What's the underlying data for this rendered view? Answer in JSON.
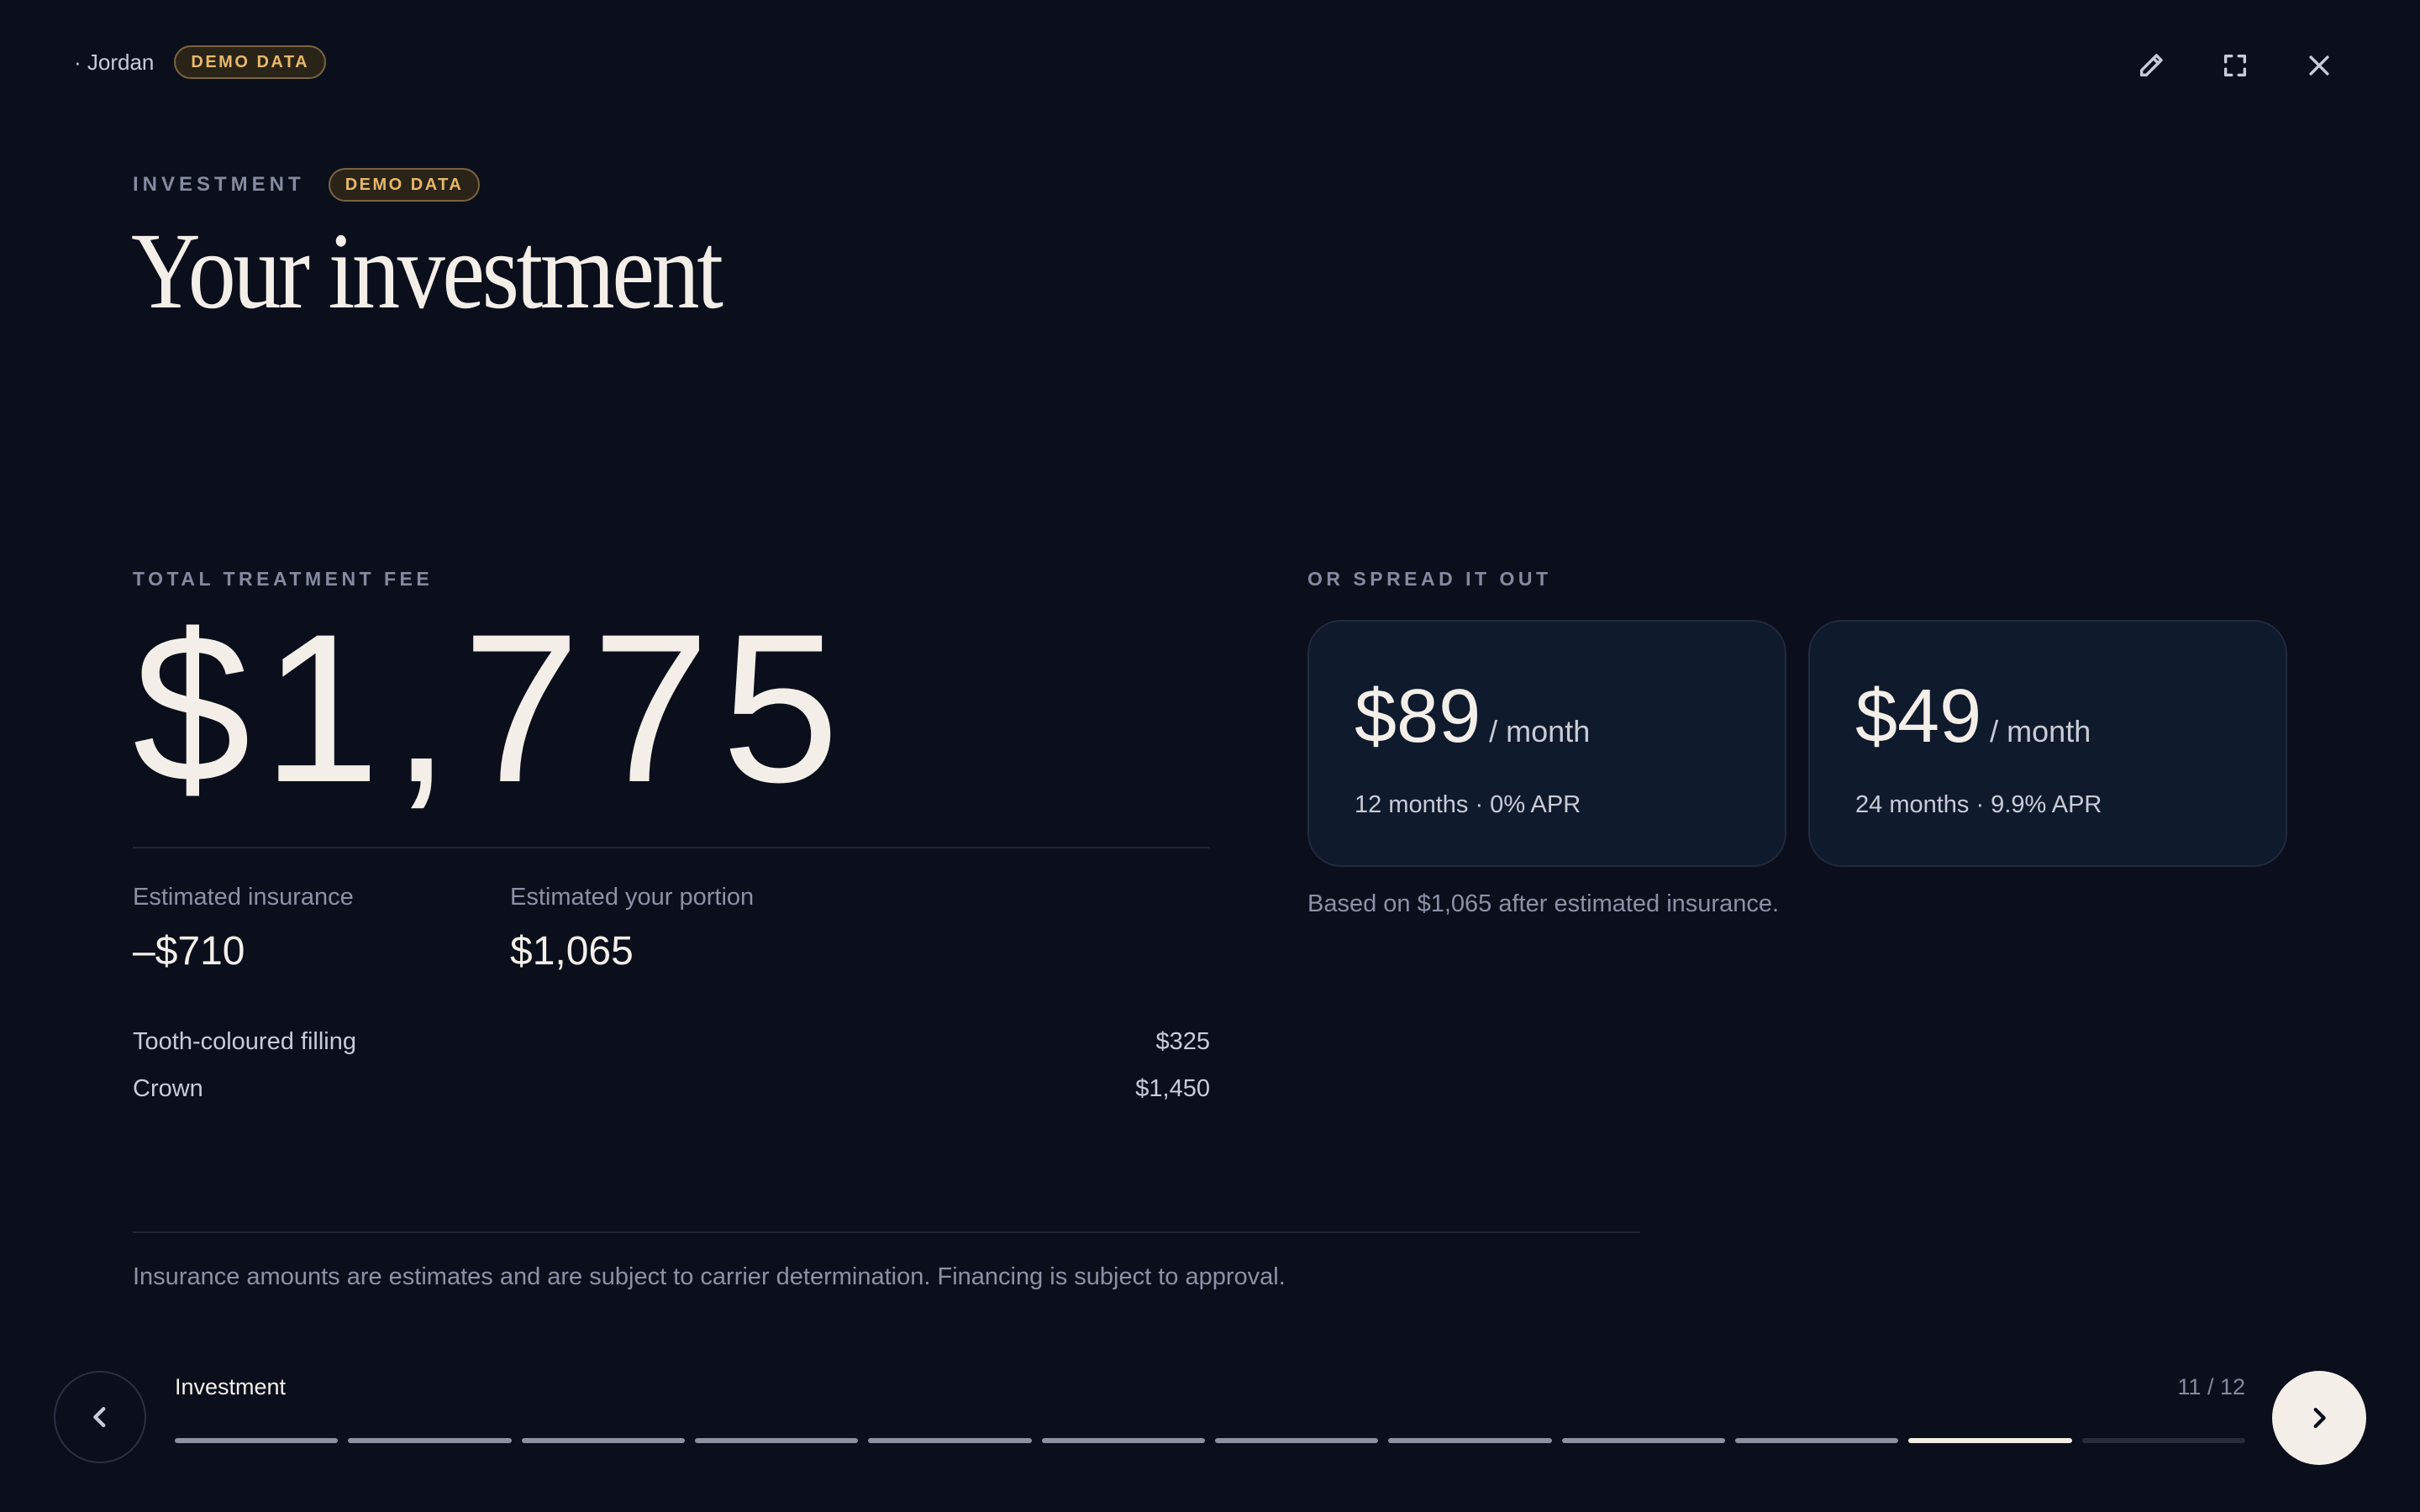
{
  "header": {
    "patient_name": "· Jordan",
    "demo_badge": "DEMO DATA"
  },
  "top_actions": {
    "icons": [
      "pencil-icon",
      "fullscreen-icon",
      "close-icon"
    ]
  },
  "slide": {
    "eyebrow": "INVESTMENT",
    "badge": "DEMO DATA",
    "title": "Your investment"
  },
  "fee": {
    "label": "TOTAL TREATMENT FEE",
    "total": "$1,775",
    "insurance_label": "Estimated insurance",
    "insurance_value": "–$710",
    "portion_label": "Estimated your portion",
    "portion_value": "$1,065",
    "line_items": [
      {
        "name": "Tooth-coloured filling",
        "price": "$325"
      },
      {
        "name": "Crown",
        "price": "$1,450"
      }
    ]
  },
  "financing": {
    "label": "OR SPREAD IT OUT",
    "plans": [
      {
        "amount": "$89",
        "per": "/ month",
        "terms": "12 months · 0% APR"
      },
      {
        "amount": "$49",
        "per": "/ month",
        "terms": "24 months · 9.9% APR"
      }
    ],
    "note": "Based on $1,065 after estimated insurance."
  },
  "disclaimer": "Insurance amounts are estimates and are subject to carrier determination. Financing is subject to approval.",
  "navigation": {
    "step_name": "Investment",
    "counter": "11 / 12",
    "current_step": 11,
    "total_steps": 12,
    "prev_icon": "chevron-left-icon",
    "next_icon": "chevron-right-icon"
  },
  "colors": {
    "background": "#0b0f1c",
    "card": "#101a2d",
    "accent_badge": "#e8b86a",
    "text_primary": "#f3efe8"
  }
}
